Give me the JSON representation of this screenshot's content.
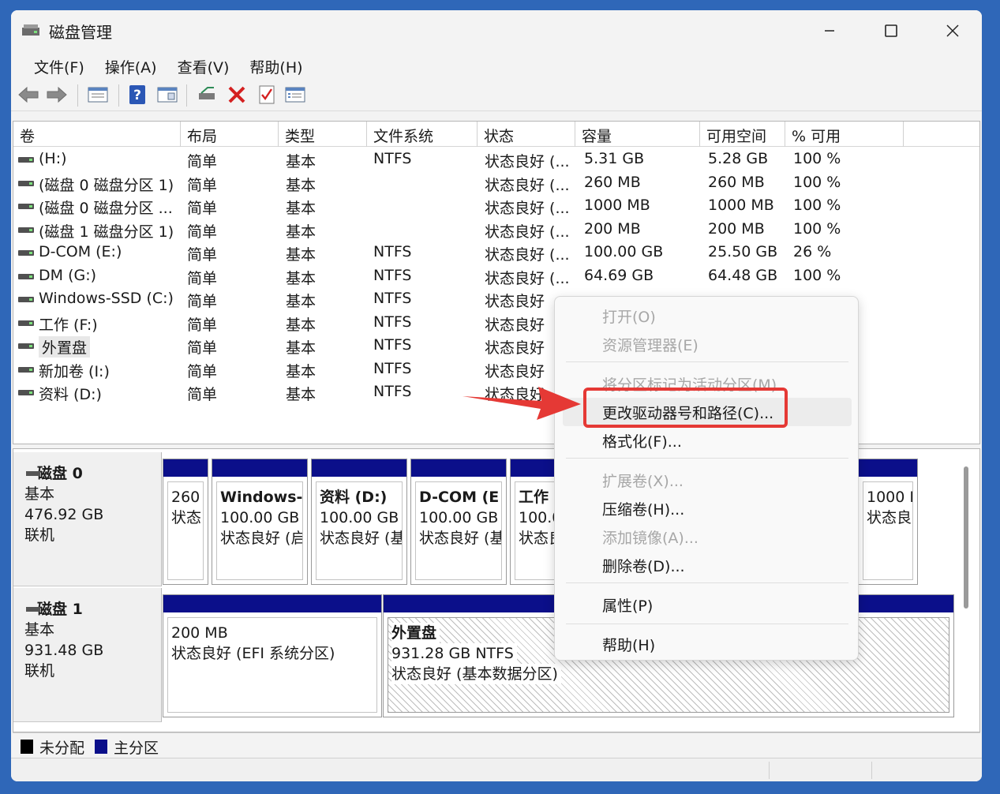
{
  "window": {
    "title": "磁盘管理"
  },
  "menu": [
    {
      "label": "文件(F)"
    },
    {
      "label": "操作(A)"
    },
    {
      "label": "查看(V)"
    },
    {
      "label": "帮助(H)"
    }
  ],
  "toolbar": {
    "icons": [
      "back-arrow-icon",
      "forward-arrow-icon",
      "list-view-icon",
      "help-icon",
      "properties-icon",
      "connect-drive-icon",
      "delete-icon",
      "check-icon",
      "settings-list-icon"
    ]
  },
  "volume_list": {
    "columns": [
      "卷",
      "布局",
      "类型",
      "文件系统",
      "状态",
      "容量",
      "可用空间",
      "% 可用"
    ],
    "rows": [
      {
        "vol": "(H:)",
        "layout": "简单",
        "type": "基本",
        "fs": "NTFS",
        "status": "状态良好 (...",
        "capacity": "5.31 GB",
        "free": "5.28 GB",
        "pct": "100 %"
      },
      {
        "vol": "(磁盘 0 磁盘分区 1)",
        "layout": "简单",
        "type": "基本",
        "fs": "",
        "status": "状态良好 (...",
        "capacity": "260 MB",
        "free": "260 MB",
        "pct": "100 %"
      },
      {
        "vol": "(磁盘 0 磁盘分区 ...",
        "layout": "简单",
        "type": "基本",
        "fs": "",
        "status": "状态良好 (...",
        "capacity": "1000 MB",
        "free": "1000 MB",
        "pct": "100 %"
      },
      {
        "vol": "(磁盘 1 磁盘分区 1)",
        "layout": "简单",
        "type": "基本",
        "fs": "",
        "status": "状态良好 (...",
        "capacity": "200 MB",
        "free": "200 MB",
        "pct": "100 %"
      },
      {
        "vol": "D-COM (E:)",
        "layout": "简单",
        "type": "基本",
        "fs": "NTFS",
        "status": "状态良好 (...",
        "capacity": "100.00 GB",
        "free": "25.50 GB",
        "pct": "26 %"
      },
      {
        "vol": "DM (G:)",
        "layout": "简单",
        "type": "基本",
        "fs": "NTFS",
        "status": "状态良好 (...",
        "capacity": "64.69 GB",
        "free": "64.48 GB",
        "pct": "100 %"
      },
      {
        "vol": "Windows-SSD (C:)",
        "layout": "简单",
        "type": "基本",
        "fs": "NTFS",
        "status": "状态良好",
        "capacity": "",
        "free": "",
        "pct": ""
      },
      {
        "vol": "工作 (F:)",
        "layout": "简单",
        "type": "基本",
        "fs": "NTFS",
        "status": "状态良好",
        "capacity": "",
        "free": "",
        "pct": ""
      },
      {
        "vol": "外置盘",
        "layout": "简单",
        "type": "基本",
        "fs": "NTFS",
        "status": "状态良好",
        "capacity": "",
        "free": "",
        "pct": ""
      },
      {
        "vol": "新加卷 (I:)",
        "layout": "简单",
        "type": "基本",
        "fs": "NTFS",
        "status": "状态良好",
        "capacity": "",
        "free": "",
        "pct": ""
      },
      {
        "vol": "资料 (D:)",
        "layout": "简单",
        "type": "基本",
        "fs": "NTFS",
        "status": "状态良好",
        "capacity": "",
        "free": "",
        "pct": ""
      }
    ]
  },
  "disks": [
    {
      "name": "磁盘 0",
      "type": "基本",
      "size": "476.92 GB",
      "state": "联机",
      "partitions": [
        {
          "name": "",
          "line1": "260",
          "line2": "状态"
        },
        {
          "name": "Windows-",
          "line1": "100.00 GB",
          "line2": "状态良好 (启"
        },
        {
          "name": "资料 (D:)",
          "line1": "100.00 GB",
          "line2": "状态良好 (基"
        },
        {
          "name": "D-COM (E",
          "line1": "100.00 GB",
          "line2": "状态良好 (基"
        },
        {
          "name": "工作",
          "line1": "100.0",
          "line2": "状态良"
        },
        {
          "name": "",
          "line1": "1000 I",
          "line2": "状态良"
        }
      ]
    },
    {
      "name": "磁盘 1",
      "type": "基本",
      "size": "931.48 GB",
      "state": "联机",
      "partitions": [
        {
          "name": "",
          "line1": "200 MB",
          "line2": "状态良好 (EFI 系统分区)"
        },
        {
          "name": "外置盘",
          "line1": "931.28 GB NTFS",
          "line2": "状态良好 (基本数据分区)"
        }
      ]
    }
  ],
  "legend": [
    {
      "label": "未分配",
      "color": "#000000"
    },
    {
      "label": "主分区",
      "color": "#0b0f8a"
    }
  ],
  "context_menu": {
    "items": [
      {
        "label": "打开(O)",
        "enabled": false
      },
      {
        "label": "资源管理器(E)",
        "enabled": false
      },
      {
        "label": "将分区标记为活动分区(M)",
        "enabled": false
      },
      {
        "label": "更改驱动器号和路径(C)...",
        "enabled": true,
        "highlighted": true
      },
      {
        "label": "格式化(F)...",
        "enabled": true
      },
      {
        "label": "扩展卷(X)...",
        "enabled": false
      },
      {
        "label": "压缩卷(H)...",
        "enabled": true
      },
      {
        "label": "添加镜像(A)...",
        "enabled": false
      },
      {
        "label": "删除卷(D)...",
        "enabled": true
      },
      {
        "label": "属性(P)",
        "enabled": true
      },
      {
        "label": "帮助(H)",
        "enabled": true
      }
    ]
  },
  "colors": {
    "accent_annotation": "#e53935",
    "primary_partition": "#0b0f8a",
    "desktop": "#2f67b8"
  }
}
